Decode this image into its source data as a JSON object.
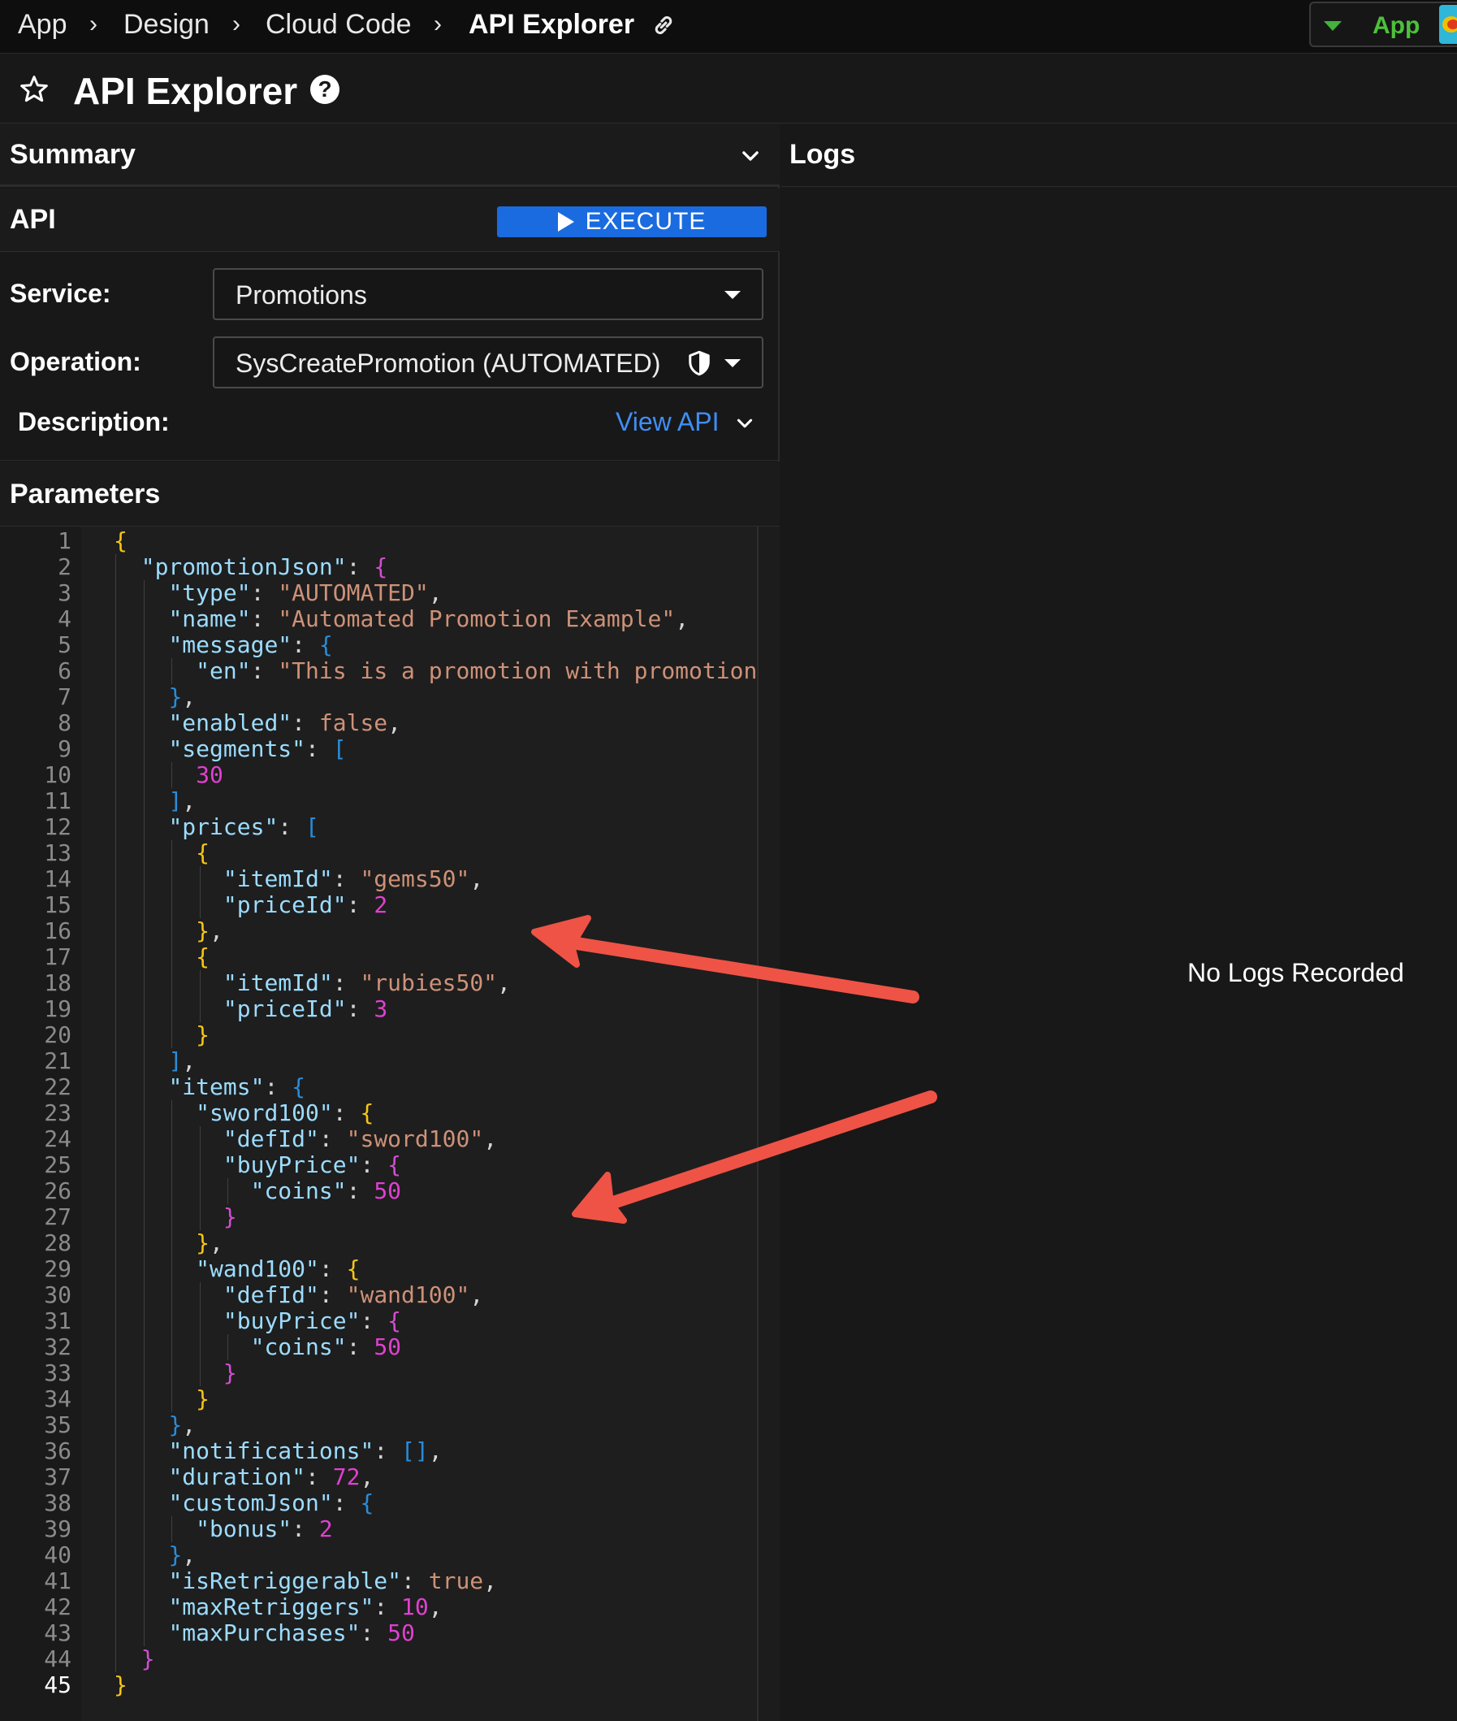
{
  "breadcrumb": {
    "items": [
      "App",
      "Design",
      "Cloud Code",
      "API Explorer"
    ],
    "separator": ">"
  },
  "app_switcher": {
    "label": "App"
  },
  "page": {
    "title": "API Explorer"
  },
  "summary": {
    "title": "Summary"
  },
  "api": {
    "title": "API",
    "execute_label": "EXECUTE",
    "service_label": "Service:",
    "service_value": "Promotions",
    "operation_label": "Operation:",
    "operation_value": "SysCreatePromotion (AUTOMATED)",
    "description_label": "Description:",
    "view_api_label": "View API"
  },
  "parameters": {
    "title": "Parameters",
    "current_line": 45,
    "code_lines": [
      "{",
      "  \"promotionJson\": {",
      "    \"type\": \"AUTOMATED\",",
      "    \"name\": \"Automated Promotion Example\",",
      "    \"message\": {",
      "      \"en\": \"This is a promotion with promotiona",
      "    },",
      "    \"enabled\": false,",
      "    \"segments\": [",
      "      30",
      "    ],",
      "    \"prices\": [",
      "      {",
      "        \"itemId\": \"gems50\",",
      "        \"priceId\": 2",
      "      },",
      "      {",
      "        \"itemId\": \"rubies50\",",
      "        \"priceId\": 3",
      "      }",
      "    ],",
      "    \"items\": {",
      "      \"sword100\": {",
      "        \"defId\": \"sword100\",",
      "        \"buyPrice\": {",
      "          \"coins\": 50",
      "        }",
      "      },",
      "      \"wand100\": {",
      "        \"defId\": \"wand100\",",
      "        \"buyPrice\": {",
      "          \"coins\": 50",
      "        }",
      "      }",
      "    },",
      "    \"notifications\": [],",
      "    \"duration\": 72,",
      "    \"customJson\": {",
      "      \"bonus\": 2",
      "    },",
      "    \"isRetriggerable\": true,",
      "    \"maxRetriggers\": 10,",
      "    \"maxPurchases\": 50",
      "  }",
      "}"
    ]
  },
  "logs": {
    "title": "Logs",
    "empty_message": "No Logs Recorded"
  },
  "colors": {
    "accent": "#1a6be0",
    "link": "#3f8ef7",
    "app_green": "#4cc13a",
    "arrow_red": "#ef5346"
  }
}
